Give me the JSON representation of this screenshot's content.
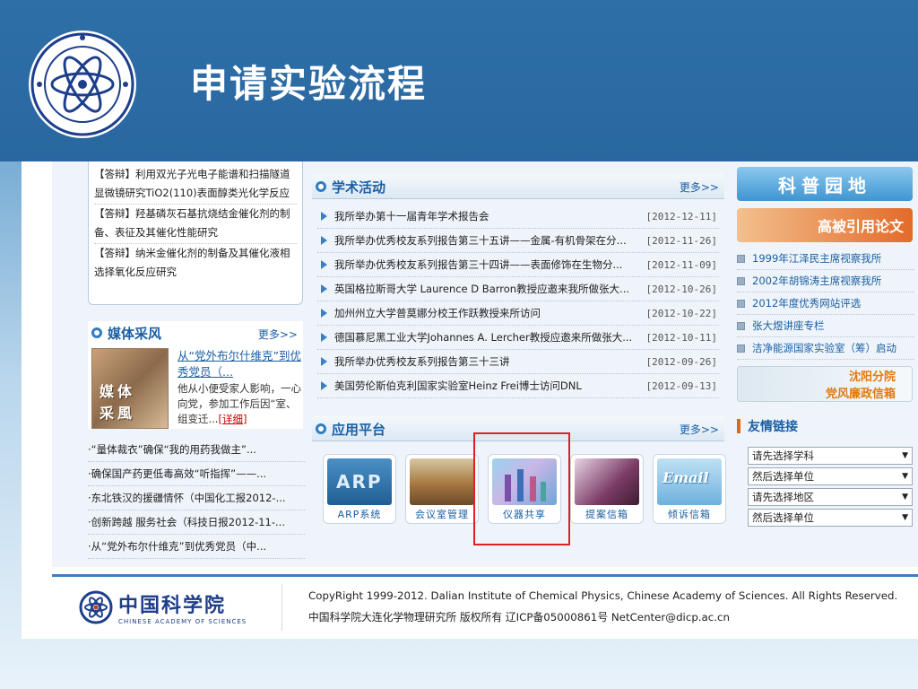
{
  "slide": {
    "title": "申请实验流程",
    "logo_icon": "dicp-atom-logo-icon"
  },
  "left": {
    "qa_items": [
      "【答辩】利用双光子光电子能谱和扫描隧道显微镜研究TiO2(110)表面醇类光化学反应",
      "【答辩】羟基磷灰石基抗烧结金催化剂的制备、表征及其催化性能研究",
      "【答辩】纳米金催化剂的制备及其催化液相选择氧化反应研究"
    ],
    "media": {
      "title": "媒体采风",
      "more": "更多>>",
      "image_text": [
        "媒",
        "体",
        "采",
        "風"
      ],
      "link": "从“党外布尔什维克”到优秀党员（...",
      "desc": "他从小便受家人影响，一心向党，参加工作后因“室、组变迁...",
      "detail": "[详细]"
    },
    "news": [
      "·“量体裁衣”确保“我的用药我做主”...",
      "·确保国产药更低毒高效“听指挥”——...",
      "·东北铁汉的援疆情怀（中国化工报2012-...",
      "·创新跨越 服务社会（科技日报2012-11-...",
      "·从“党外布尔什维克”到优秀党员（中..."
    ]
  },
  "academic": {
    "title": "学术活动",
    "more": "更多>>",
    "rows": [
      {
        "title": "我所举办第十一届青年学术报告会",
        "date": "[2012-12-11]"
      },
      {
        "title": "我所举办优秀校友系列报告第三十五讲——金属-有机骨架在分...",
        "date": "[2012-11-26]"
      },
      {
        "title": "我所举办优秀校友系列报告第三十四讲——表面修饰在生物分...",
        "date": "[2012-11-09]"
      },
      {
        "title": "英国格拉斯哥大学 Laurence D Barron教授应邀来我所做张大...",
        "date": "[2012-10-26]"
      },
      {
        "title": "加州州立大学普莫娜分校王作跃教授来所访问",
        "date": "[2012-10-22]"
      },
      {
        "title": "德国慕尼黑工业大学Johannes A. Lercher教授应邀来所做张大...",
        "date": "[2012-10-11]"
      },
      {
        "title": "我所举办优秀校友系列报告第三十三讲",
        "date": "[2012-09-26]"
      },
      {
        "title": "美国劳伦斯伯克利国家实验室Heinz Frei博士访问DNL",
        "date": "[2012-09-13]"
      }
    ]
  },
  "apps": {
    "title": "应用平台",
    "more": "更多>>",
    "items": [
      {
        "label": "ARP系统",
        "pic_text": "ARP"
      },
      {
        "label": "会议室管理",
        "pic_text": ""
      },
      {
        "label": "仪器共享",
        "pic_text": ""
      },
      {
        "label": "提案信箱",
        "pic_text": ""
      },
      {
        "label": "倾诉信箱",
        "pic_text": "Email"
      }
    ]
  },
  "right": {
    "banner1": "科普园地",
    "banner2": "高被引用论文",
    "banner3_line1": "沈阳分院",
    "banner3_line2": "党风廉政信箱",
    "links": [
      "1999年江泽民主席视察我所",
      "2002年胡锦涛主席视察我所",
      "2012年度优秀网站评选",
      "张大煜讲座专栏",
      "洁净能源国家实验室（筹）启动"
    ],
    "friend_title": "友情链接",
    "selects": [
      "请先选择学科",
      "然后选择单位",
      "请先选择地区",
      "然后选择单位"
    ]
  },
  "footer": {
    "cas_cn": "中国科学院",
    "cas_en": "CHINESE ACADEMY OF SCIENCES",
    "copyright": "CopyRight 1999-2012. Dalian Institute of Chemical Physics, Chinese Academy of Sciences. All Rights Reserved.",
    "info": "中国科学院大连化学物理研究所 版权所有 辽ICP备05000861号 NetCenter@dicp.ac.cn"
  },
  "colors": {
    "header_blue": "#2a67a0",
    "link_blue": "#1b5fa3",
    "highlight_red": "#e02020"
  }
}
